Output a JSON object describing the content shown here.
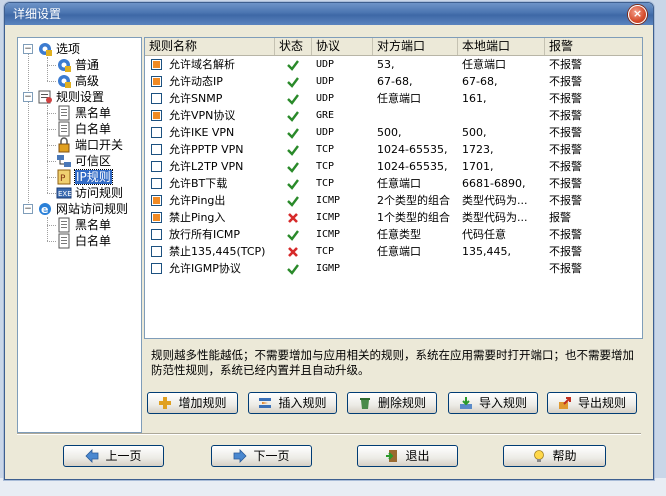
{
  "window": {
    "title": "详细设置",
    "close_label": "×"
  },
  "tree": {
    "items": [
      {
        "label": "选项",
        "level": 0,
        "icon": "gear-icon"
      },
      {
        "label": "普通",
        "level": 1,
        "icon": "gear-icon"
      },
      {
        "label": "高级",
        "level": 1,
        "icon": "gear-icon"
      },
      {
        "label": "规则设置",
        "level": 0,
        "icon": "settings-doc-icon"
      },
      {
        "label": "黑名单",
        "level": 1,
        "icon": "doc-icon"
      },
      {
        "label": "白名单",
        "level": 1,
        "icon": "doc-icon"
      },
      {
        "label": "端口开关",
        "level": 1,
        "icon": "lock-icon"
      },
      {
        "label": "可信区",
        "level": 1,
        "icon": "network-icon"
      },
      {
        "label": "IP规则",
        "level": 1,
        "icon": "ip-rule-icon",
        "selected": true
      },
      {
        "label": "访问规则",
        "level": 1,
        "icon": "exe-icon"
      },
      {
        "label": "网站访问规则",
        "level": 0,
        "icon": "ie-icon"
      },
      {
        "label": "黑名单",
        "level": 1,
        "icon": "doc-icon"
      },
      {
        "label": "白名单",
        "level": 1,
        "icon": "doc-icon"
      }
    ]
  },
  "list": {
    "headers": [
      "规则名称",
      "状态",
      "协议",
      "对方端口",
      "本地端口",
      "报警"
    ],
    "rows": [
      {
        "checked": true,
        "name": "允许域名解析",
        "status": "ok",
        "protocol": "UDP",
        "remote": "53,",
        "local": "任意端口",
        "alarm": "不报警"
      },
      {
        "checked": true,
        "name": "允许动态IP",
        "status": "ok",
        "protocol": "UDP",
        "remote": "67-68,",
        "local": "67-68,",
        "alarm": "不报警"
      },
      {
        "checked": false,
        "name": "允许SNMP",
        "status": "ok",
        "protocol": "UDP",
        "remote": "任意端口",
        "local": "161,",
        "alarm": "不报警"
      },
      {
        "checked": true,
        "name": "允许VPN协议",
        "status": "ok",
        "protocol": "GRE",
        "remote": "",
        "local": "",
        "alarm": "不报警"
      },
      {
        "checked": false,
        "name": "允许IKE VPN",
        "status": "ok",
        "protocol": "UDP",
        "remote": "500,",
        "local": "500,",
        "alarm": "不报警"
      },
      {
        "checked": false,
        "name": "允许PPTP VPN",
        "status": "ok",
        "protocol": "TCP",
        "remote": "1024-65535,",
        "local": "1723,",
        "alarm": "不报警"
      },
      {
        "checked": false,
        "name": "允许L2TP VPN",
        "status": "ok",
        "protocol": "TCP",
        "remote": "1024-65535,",
        "local": "1701,",
        "alarm": "不报警"
      },
      {
        "checked": false,
        "name": "允许BT下载",
        "status": "ok",
        "protocol": "TCP",
        "remote": "任意端口",
        "local": "6681-6890,",
        "alarm": "不报警"
      },
      {
        "checked": true,
        "name": "允许Ping出",
        "status": "ok",
        "protocol": "ICMP",
        "remote": "2个类型的组合",
        "local": "类型代码为...",
        "alarm": "不报警"
      },
      {
        "checked": true,
        "name": "禁止Ping入",
        "status": "no",
        "protocol": "ICMP",
        "remote": "1个类型的组合",
        "local": "类型代码为...",
        "alarm": "报警"
      },
      {
        "checked": false,
        "name": "放行所有ICMP",
        "status": "ok",
        "protocol": "ICMP",
        "remote": "任意类型",
        "local": "代码任意",
        "alarm": "不报警"
      },
      {
        "checked": false,
        "name": "禁止135,445(TCP)",
        "status": "no",
        "protocol": "TCP",
        "remote": "任意端口",
        "local": "135,445,",
        "alarm": "不报警"
      },
      {
        "checked": false,
        "name": "允许IGMP协议",
        "status": "ok",
        "protocol": "IGMP",
        "remote": "",
        "local": "",
        "alarm": "不报警"
      }
    ]
  },
  "description": "规则越多性能越低；不需要增加与应用相关的规则，系统在应用需要时打开端口；也不需要增加防范性规则，系统已经内置并且自动升级。",
  "rule_buttons": {
    "add": "增加规则",
    "insert": "插入规则",
    "delete": "删除规则",
    "import": "导入规则",
    "export": "导出规则"
  },
  "nav_buttons": {
    "prev": "上一页",
    "next": "下一页",
    "exit": "退出",
    "help": "帮助"
  },
  "colors": {
    "accent": "#316ac5",
    "ok": "#2a8a2a",
    "blocked": "#d62a2a",
    "checkbox_fill": "#f08a24"
  }
}
